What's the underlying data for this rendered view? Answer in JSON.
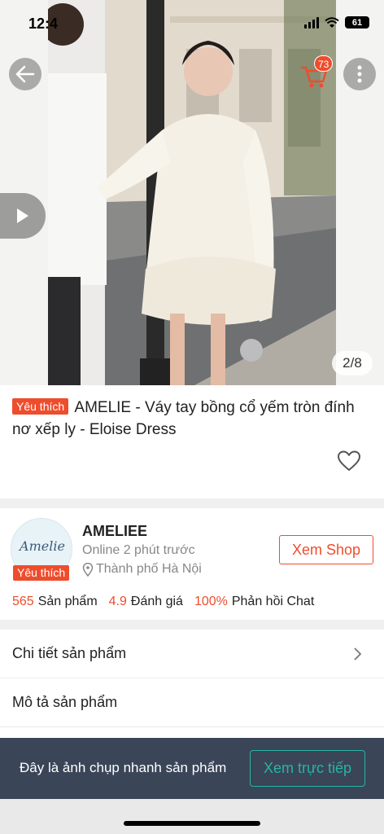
{
  "status_bar": {
    "time": "12:4",
    "battery": "61"
  },
  "gallery": {
    "counter": "2/8",
    "cart_count": "73"
  },
  "product": {
    "badge": "Yêu thích",
    "title": "AMELIE - Váy tay bồng cổ yếm tròn đính nơ xếp ly - Eloise Dress"
  },
  "shop": {
    "logo_text": "Amelie",
    "badge": "Yêu thích",
    "name": "AMELIEE",
    "online": "Online 2 phút trước",
    "location": "Thành phố Hà Nội",
    "view_button": "Xem Shop",
    "stats": [
      {
        "value": "565",
        "label": "Sản phẩm"
      },
      {
        "value": "4.9",
        "label": "Đánh giá"
      },
      {
        "value": "100%",
        "label": "Phản hồi Chat"
      }
    ]
  },
  "sections": {
    "details": "Chi tiết sản phẩm",
    "description": "Mô tả sản phẩm"
  },
  "snapshot": {
    "text": "Đây là ảnh chụp nhanh sản phẩm",
    "button": "Xem trực tiếp"
  },
  "colors": {
    "accent": "#ee4d2d",
    "teal": "#27b4a6",
    "snapshot_bg": "#3a4558"
  }
}
